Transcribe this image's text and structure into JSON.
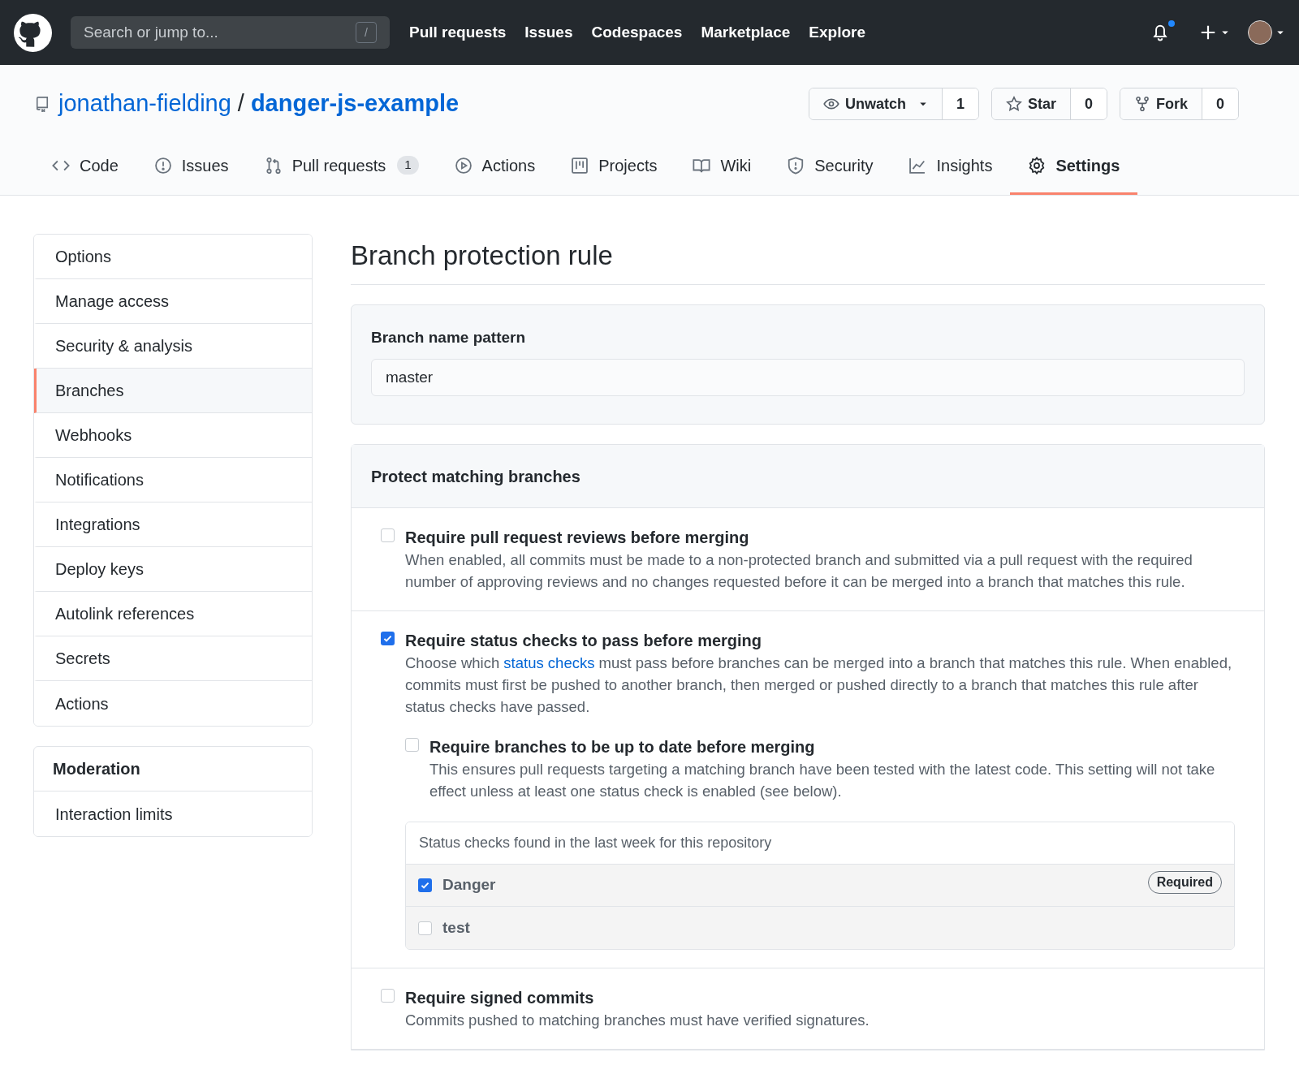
{
  "header": {
    "search": {
      "placeholder": "Search or jump to...",
      "shortcut": "/"
    },
    "nav": [
      "Pull requests",
      "Issues",
      "Codespaces",
      "Marketplace",
      "Explore"
    ],
    "notification_unread": true
  },
  "repo": {
    "owner": "jonathan-fielding",
    "separator": "/",
    "name": "danger-js-example",
    "actions": [
      {
        "kind": "watch",
        "label": "Unwatch",
        "count": "1"
      },
      {
        "kind": "star",
        "label": "Star",
        "count": "0"
      },
      {
        "kind": "fork",
        "label": "Fork",
        "count": "0"
      }
    ]
  },
  "tabs": [
    {
      "kind": "code",
      "label": "Code",
      "selected": false
    },
    {
      "kind": "issues",
      "label": "Issues",
      "selected": false
    },
    {
      "kind": "pulls",
      "label": "Pull requests",
      "counter": "1",
      "selected": false
    },
    {
      "kind": "actions",
      "label": "Actions",
      "selected": false
    },
    {
      "kind": "projects",
      "label": "Projects",
      "selected": false
    },
    {
      "kind": "wiki",
      "label": "Wiki",
      "selected": false
    },
    {
      "kind": "security",
      "label": "Security",
      "selected": false
    },
    {
      "kind": "insights",
      "label": "Insights",
      "selected": false
    },
    {
      "kind": "settings",
      "label": "Settings",
      "selected": true
    }
  ],
  "sidebar": {
    "groups": [
      {
        "items": [
          {
            "label": "Options",
            "selected": false
          },
          {
            "label": "Manage access",
            "selected": false
          },
          {
            "label": "Security & analysis",
            "selected": false
          },
          {
            "label": "Branches",
            "selected": true
          },
          {
            "label": "Webhooks",
            "selected": false
          },
          {
            "label": "Notifications",
            "selected": false
          },
          {
            "label": "Integrations",
            "selected": false
          },
          {
            "label": "Deploy keys",
            "selected": false
          },
          {
            "label": "Autolink references",
            "selected": false
          },
          {
            "label": "Secrets",
            "selected": false
          },
          {
            "label": "Actions",
            "selected": false
          }
        ]
      },
      {
        "heading": "Moderation",
        "items": [
          {
            "label": "Interaction limits",
            "selected": false
          }
        ]
      }
    ]
  },
  "main": {
    "title": "Branch protection rule",
    "pattern": {
      "label": "Branch name pattern",
      "value": "master"
    },
    "protect": {
      "title": "Protect matching branches",
      "rules": [
        {
          "title": "Require pull request reviews before merging",
          "checked": false,
          "description": [
            {
              "text": "When enabled, all commits must be made to a non-protected branch and submitted via a pull request with the required number of approving reviews and no changes requested before it can be merged into a branch that matches this rule."
            }
          ]
        },
        {
          "title": "Require status checks to pass before merging",
          "checked": true,
          "description": [
            {
              "text": "Choose which "
            },
            {
              "text": "status checks",
              "kind": "link"
            },
            {
              "text": " must pass before branches can be merged into a branch that matches this rule. When enabled, commits must first be pushed to another branch, then merged or pushed directly to a branch that matches this rule after status checks have passed."
            }
          ],
          "children": [
            {
              "title": "Require branches to be up to date before merging",
              "checked": false,
              "description": [
                {
                  "text": "This ensures pull requests targeting a matching branch have been tested with the latest code. This setting will not take effect unless at least one status check is enabled (see below)."
                }
              ]
            }
          ],
          "checks": {
            "heading": "Status checks found in the last week for this repository",
            "items": [
              {
                "name": "Danger",
                "checked": true,
                "badge": "Required"
              },
              {
                "name": "test",
                "checked": false
              }
            ]
          }
        },
        {
          "title": "Require signed commits",
          "checked": false,
          "description": [
            {
              "text": "Commits pushed to matching branches must have verified signatures."
            }
          ]
        }
      ]
    }
  }
}
